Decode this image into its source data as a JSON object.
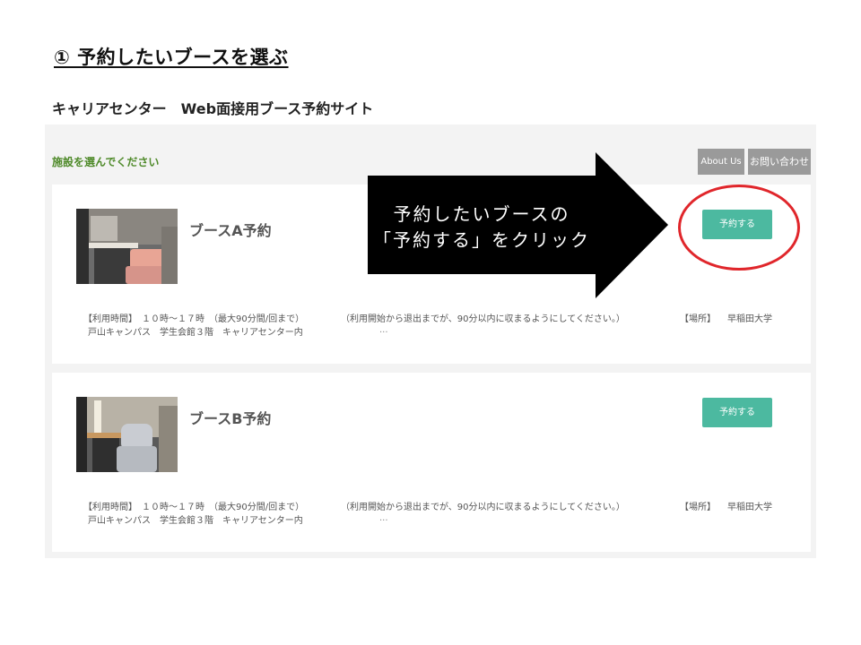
{
  "step_title": "① 予約したいブースを選ぶ",
  "site_title": "キャリアセンター　Web面接用ブース予約サイト",
  "select_label": "施設を選んでください",
  "top_buttons": {
    "about": "About Us",
    "contact": "お問い合わせ"
  },
  "callout": {
    "line1": "予約したいブースの",
    "line2": "「予約する」をクリック"
  },
  "booths": [
    {
      "name": "ブースA予約",
      "reserve_label": "予約する",
      "hours": "【利用時間】　１０時～１７時　（最大90分間/回まで）",
      "note": "（利用開始から退出までが、90分以内に収まるようにしてください。）",
      "place_label": "【場所】",
      "place": "早稲田大学",
      "campus": "戸山キャンパス　学生会館３階　キャリアセンター内",
      "ellipsis": "..."
    },
    {
      "name": "ブースB予約",
      "reserve_label": "予約する",
      "hours": "【利用時間】　１０時～１７時　（最大90分間/回まで）",
      "note": "（利用開始から退出までが、90分以内に収まるようにしてください。）",
      "place_label": "【場所】",
      "place": "早稲田大学",
      "campus": "戸山キャンパス　学生会館３階　キャリアセンター内",
      "ellipsis": "..."
    }
  ],
  "colors": {
    "accent_green": "#4cb9a0",
    "label_green": "#4f8a2a",
    "highlight_red": "#e0262b",
    "callout_black": "#000000",
    "header_button_gray": "#9a9a9a"
  }
}
